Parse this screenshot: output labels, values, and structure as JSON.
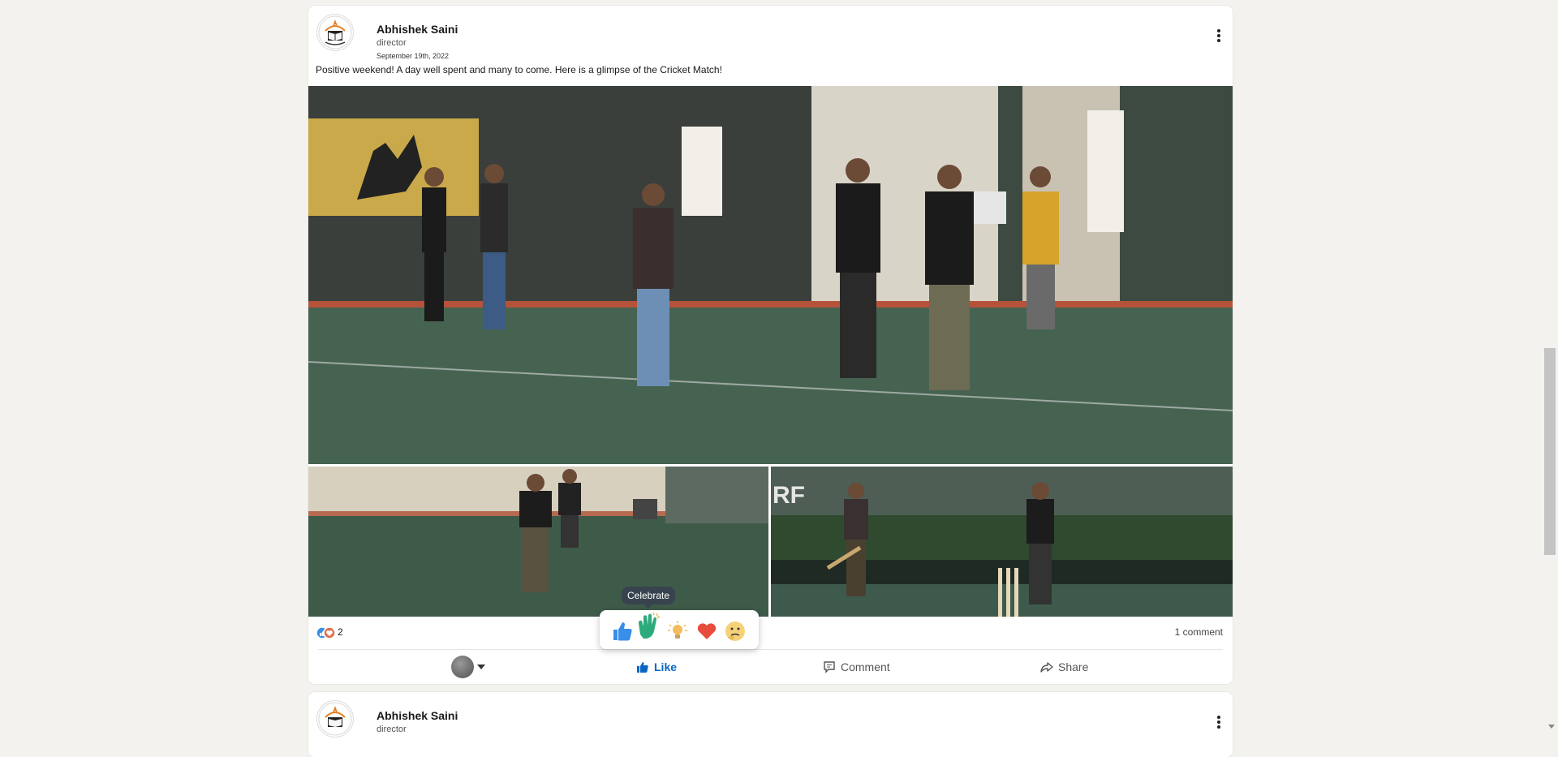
{
  "posts": [
    {
      "author": "Abhishek Saini",
      "role": "director",
      "date": "September 19th, 2022",
      "caption": "Positive weekend! A day well spent and many to come. Here is a glimpse of the Cricket Match!",
      "reaction_count": "2",
      "comments": "1 comment",
      "actions": {
        "like": "Like",
        "comment": "Comment",
        "share": "Share"
      }
    },
    {
      "author": "Abhishek Saini",
      "role": "director"
    }
  ],
  "reaction_tooltip": "Celebrate",
  "reactions": [
    "like-icon",
    "celebrate-icon",
    "insightful-icon",
    "love-icon",
    "curious-icon"
  ],
  "colors": {
    "accent": "#0a66c2",
    "page_bg": "#f3f2ef",
    "love": "#e74c3c",
    "celebrate": "#2daa7b"
  }
}
